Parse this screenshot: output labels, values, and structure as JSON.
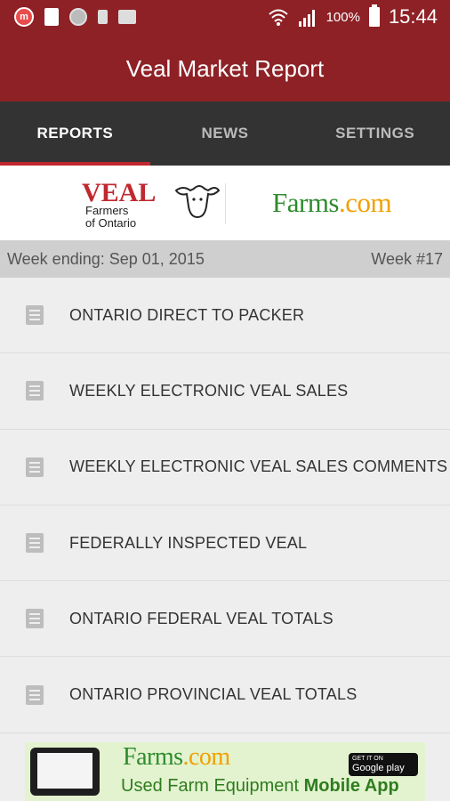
{
  "status_bar": {
    "battery": "100%",
    "time": "15:44",
    "notification_icons": [
      "messenger-icon",
      "document-icon",
      "globe-icon",
      "phone-icon",
      "mail-icon"
    ],
    "indicator_icons": [
      "wifi-icon",
      "signal-icon",
      "battery-icon"
    ]
  },
  "app_bar": {
    "title": "Veal Market Report"
  },
  "tabs": [
    {
      "label": "REPORTS",
      "active": true
    },
    {
      "label": "NEWS",
      "active": false
    },
    {
      "label": "SETTINGS",
      "active": false
    }
  ],
  "logos": {
    "veal": {
      "word": "VEAL",
      "sub1": "Farmers",
      "sub2": "of Ontario"
    },
    "farms": {
      "name": "Farms",
      "suffix": ".com"
    }
  },
  "week_bar": {
    "week_ending": "Week ending: Sep 01, 2015",
    "week_number": "Week #17"
  },
  "reports": [
    {
      "label": "ONTARIO DIRECT TO PACKER"
    },
    {
      "label": "WEEKLY ELECTRONIC VEAL SALES"
    },
    {
      "label": "WEEKLY ELECTRONIC VEAL SALES COMMENTS"
    },
    {
      "label": "FEDERALLY INSPECTED VEAL"
    },
    {
      "label": "ONTARIO FEDERAL VEAL TOTALS"
    },
    {
      "label": "ONTARIO PROVINCIAL VEAL TOTALS"
    }
  ],
  "ad": {
    "brand": "Farms",
    "brand_suffix": ".com",
    "tagline_plain": "Used Farm Equipment ",
    "tagline_bold": "Mobile App",
    "store_small": "GET IT ON",
    "store_name": "Google play"
  },
  "colors": {
    "primary": "#8e2126",
    "tab_background": "#333333",
    "tab_indicator": "#c0282f",
    "list_background": "#eeeeee",
    "week_bar": "#cfcfcf",
    "farms_green": "#2e8b2e"
  }
}
